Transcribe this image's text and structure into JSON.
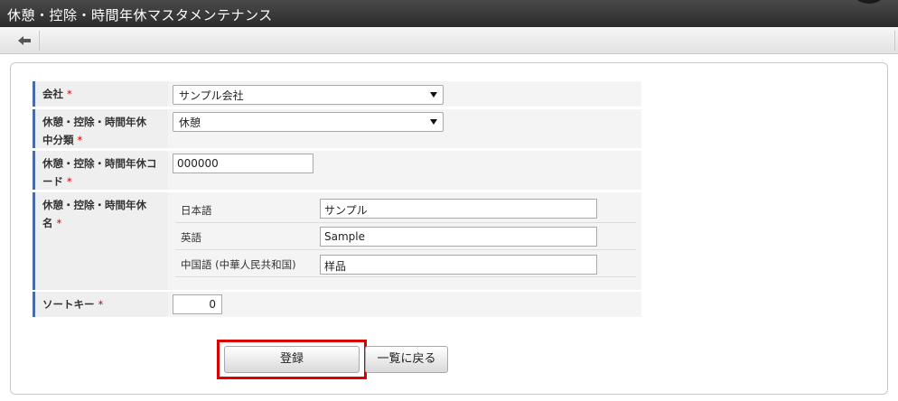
{
  "window": {
    "title": "休憩・控除・時間年休マスタメンテナンス"
  },
  "toolbar": {
    "back_icon": "arrow-left-icon"
  },
  "form": {
    "company": {
      "label": "会社",
      "required_mark": "*",
      "selected": "サンプル会社"
    },
    "category": {
      "label_line1": "休憩・控除・時間年休",
      "label_line2": "中分類",
      "required_mark": "*",
      "selected": "休憩"
    },
    "code": {
      "label_line1": "休憩・控除・時間年休コ",
      "label_line2": "ード",
      "required_mark": "*",
      "value": "000000"
    },
    "name": {
      "label_line1": "休憩・控除・時間年休",
      "label_line2": "名",
      "required_mark": "*",
      "languages": [
        {
          "label": "日本語",
          "value": "サンプル"
        },
        {
          "label": "英語",
          "value": "Sample"
        },
        {
          "label": "中国語 (中華人民共和国)",
          "value": "样品"
        }
      ]
    },
    "sort_key": {
      "label": "ソートキー",
      "required_mark": "*",
      "value": "0"
    }
  },
  "buttons": {
    "register": "登録",
    "back_to_list": "一覧に戻る"
  }
}
